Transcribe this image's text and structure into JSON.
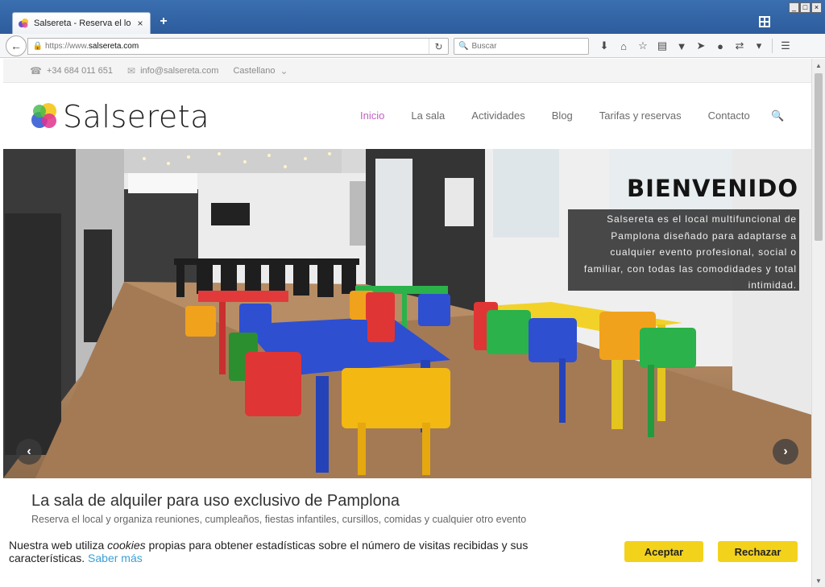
{
  "browser": {
    "tab_title": "Salsereta - Reserva el local y ...",
    "tab_close": "×",
    "new_tab": "+",
    "url_prefix": "https://www.",
    "url_domain": "salsereta.com",
    "search_placeholder": "Buscar",
    "window_buttons": [
      "_",
      "□",
      "×"
    ],
    "toolbar_icons": [
      "download-icon",
      "home-icon",
      "bookmark-star-icon",
      "reading-list-icon",
      "pocket-icon",
      "send-icon",
      "chat-icon",
      "extension-icon",
      "menu-icon"
    ]
  },
  "topbar": {
    "phone": "+34 684 011 651",
    "email": "info@salsereta.com",
    "language": "Castellano"
  },
  "header": {
    "logo_text": "Salsereta",
    "nav": [
      "Inicio",
      "La sala",
      "Actividades",
      "Blog",
      "Tarifas y reservas",
      "Contacto"
    ],
    "active_nav": "Inicio",
    "accent_color": "#c35fc4"
  },
  "hero": {
    "title": "BIENVENIDO",
    "text": "Salsereta es el local multifuncional de Pamplona diseñado para adaptarse a cualquier evento profesional, social o familiar, con todas las comodidades y total intimidad.",
    "prev_arrow": "‹",
    "next_arrow": "›"
  },
  "intro": {
    "title": "La sala de alquiler para uso exclusivo de Pamplona",
    "subtitle": "Reserva el local y organiza reuniones, cumpleaños, fiestas infantiles, cursillos, comidas y cualquier otro evento"
  },
  "cookie": {
    "text_before": "Nuestra web utiliza ",
    "text_em": "cookies",
    "text_after": " propias para obtener estadísticas sobre el número de visitas recibidas y sus características. ",
    "link": "Saber más",
    "accept": "Aceptar",
    "reject": "Rechazar",
    "button_color": "#f3d21c"
  }
}
